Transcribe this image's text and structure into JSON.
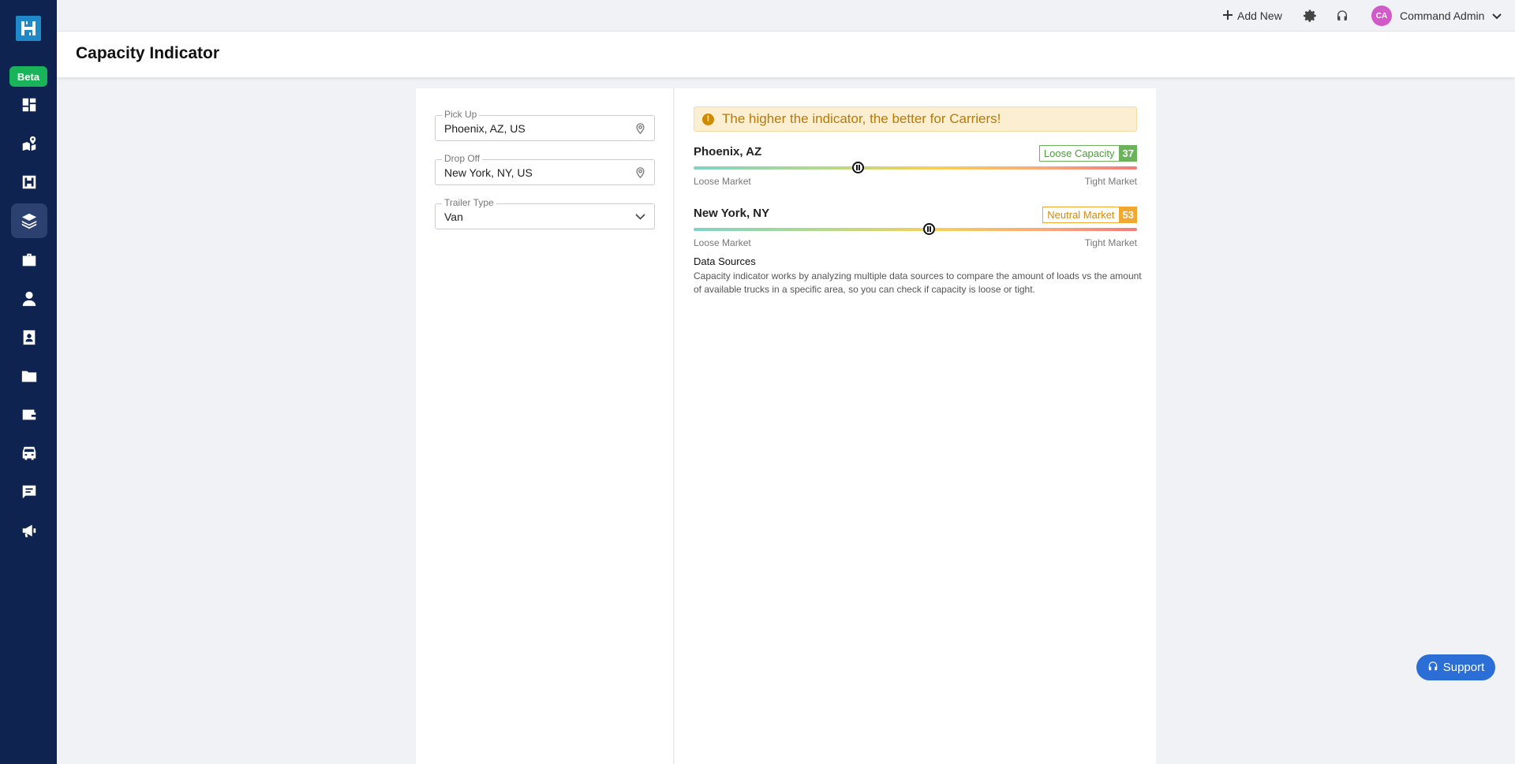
{
  "sidebar": {
    "beta_label": "Beta",
    "items": [
      {
        "icon": "dashboard-icon"
      },
      {
        "icon": "map-pin-route-icon"
      },
      {
        "icon": "load-board-icon"
      },
      {
        "icon": "layers-icon",
        "active": true
      },
      {
        "icon": "briefcase-icon"
      },
      {
        "icon": "driver-icon"
      },
      {
        "icon": "contacts-icon"
      },
      {
        "icon": "folder-icon"
      },
      {
        "icon": "wallet-icon"
      },
      {
        "icon": "truck-icon"
      },
      {
        "icon": "chat-icon"
      },
      {
        "icon": "megaphone-icon"
      }
    ]
  },
  "topbar": {
    "add_new_label": "Add New",
    "user_initials": "CA",
    "user_name": "Command Admin"
  },
  "header": {
    "title": "Capacity Indicator"
  },
  "form": {
    "pickup": {
      "label": "Pick Up",
      "value": "Phoenix, AZ, US"
    },
    "dropoff": {
      "label": "Drop Off",
      "value": "New York, NY, US"
    },
    "trailer": {
      "label": "Trailer Type",
      "value": "Van"
    }
  },
  "indicator": {
    "alert_text": "The higher the indicator, the better for Carriers!",
    "markets": [
      {
        "city": "Phoenix, AZ",
        "badge_label": "Loose Capacity",
        "value": "37",
        "level": 0.37,
        "color": "#6bb35a",
        "left_label": "Loose Market",
        "right_label": "Tight Market"
      },
      {
        "city": "New York, NY",
        "badge_label": "Neutral Market",
        "value": "53",
        "level": 0.53,
        "color": "#f0a830",
        "left_label": "Loose Market",
        "right_label": "Tight Market"
      }
    ],
    "data_sources_title": "Data Sources",
    "data_sources_text": "Capacity indicator works by analyzing multiple data sources to compare the amount of loads vs the amount of available trucks in a specific area, so you can check if capacity is loose or tight."
  },
  "support_label": "Support"
}
